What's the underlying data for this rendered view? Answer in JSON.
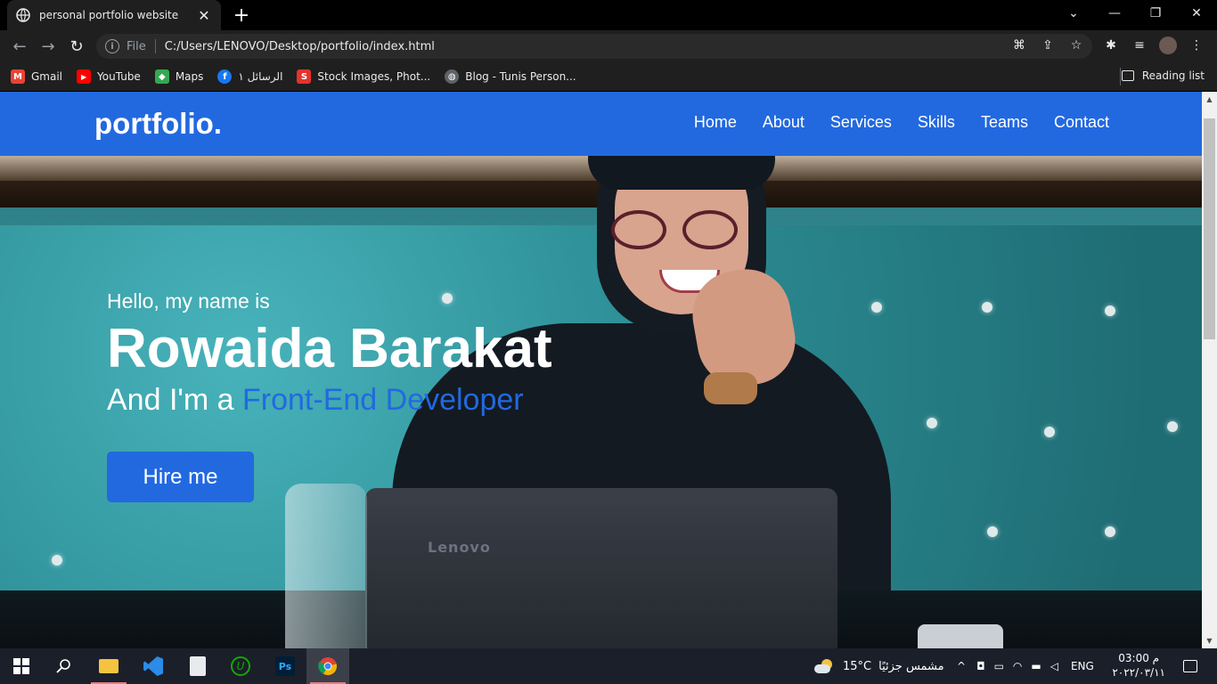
{
  "browser": {
    "tab_title": "personal portfolio website",
    "tab_close": "✕",
    "new_tab": "+",
    "url_scheme": "File",
    "url": "C:/Users/LENOVO/Desktop/portfolio/index.html",
    "bookmarks": [
      {
        "label": "Gmail",
        "icon": "gmail-icon",
        "color": "#ea4335",
        "glyph": "M"
      },
      {
        "label": "YouTube",
        "icon": "youtube-icon",
        "color": "#ff0000",
        "glyph": "▶"
      },
      {
        "label": "Maps",
        "icon": "maps-icon",
        "color": "#34a853",
        "glyph": "◆"
      },
      {
        "label": "الرسائل ١",
        "icon": "facebook-icon",
        "color": "#1877f2",
        "glyph": "f"
      },
      {
        "label": "Stock Images, Phot...",
        "icon": "stock-images-icon",
        "color": "#e4332b",
        "glyph": "S"
      },
      {
        "label": "Blog - Tunis Person...",
        "icon": "globe-icon",
        "color": "#5f6368",
        "glyph": "◍"
      }
    ],
    "reading_list": "Reading list"
  },
  "site": {
    "logo": "portfolio.",
    "menu": [
      "Home",
      "About",
      "Services",
      "Skills",
      "Teams",
      "Contact"
    ],
    "greeting": "Hello, my name is",
    "name": "Rowaida Barakat",
    "role_prefix": "And I'm a ",
    "role_typed": "Front-End Developer",
    "hire_button": "Hire me",
    "laptop_brand": "Lenovo",
    "accent_color": "#2269e0"
  },
  "taskbar": {
    "weather_temp": "15°C",
    "weather_text": "مشمس جزئيًا",
    "language": "ENG",
    "time": "03:00 م",
    "date": "٢٠٢٢/٠٣/١١",
    "apps": [
      "start-icon",
      "search-icon",
      "file-explorer-icon",
      "vscode-icon",
      "notepad-icon",
      "upwork-icon",
      "photoshop-icon",
      "chrome-icon"
    ]
  }
}
